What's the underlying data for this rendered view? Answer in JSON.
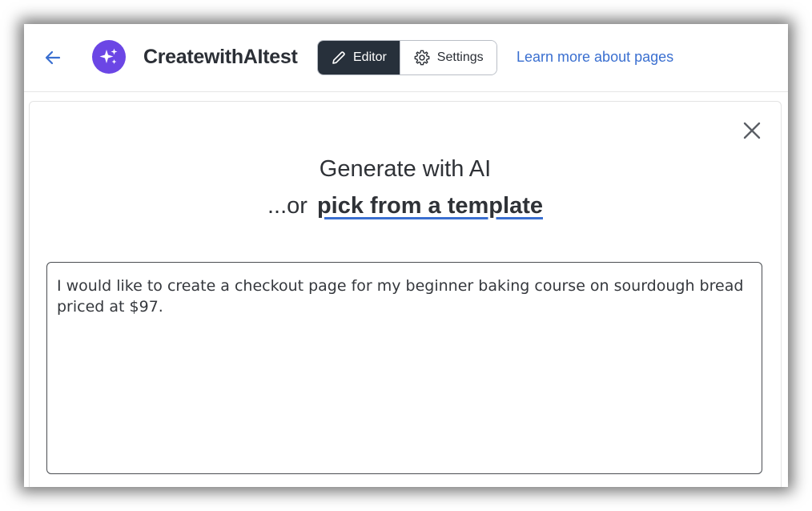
{
  "header": {
    "back_icon": "arrow-left-icon",
    "logo_icon": "sparkles-icon",
    "app_title": "CreatewithAItest",
    "tabs": [
      {
        "label": "Editor",
        "icon": "pencil-icon",
        "active": true
      },
      {
        "label": "Settings",
        "icon": "gear-icon",
        "active": false
      }
    ],
    "learn_more_link": "Learn more about pages"
  },
  "dialog": {
    "close_icon": "close-icon",
    "title": "Generate with AI",
    "subtitle_prefix": "...or",
    "template_link": "pick from a template",
    "prompt_value": "I would like to create a checkout page for my beginner baking course on sourdough bread priced at $97."
  },
  "colors": {
    "accent": "#6b46e5",
    "link": "#3a6fd0",
    "active_tab_bg": "#27303b"
  }
}
